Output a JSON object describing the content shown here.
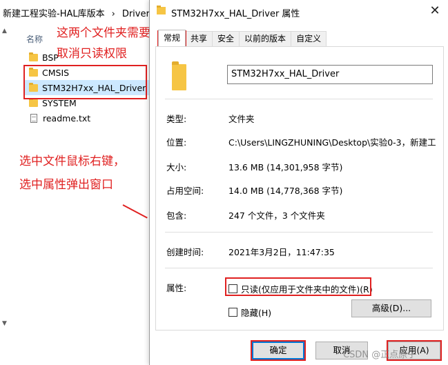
{
  "explorer": {
    "path_part1": "新建工程实验-HAL库版本",
    "path_sep": "›",
    "path_part2": "Drivers",
    "column_header": "名称",
    "items": [
      {
        "name": "BSP",
        "type": "folder"
      },
      {
        "name": "CMSIS",
        "type": "folder"
      },
      {
        "name": "STM32H7xx_HAL_Driver",
        "type": "folder",
        "selected": true
      },
      {
        "name": "SYSTEM",
        "type": "folder"
      },
      {
        "name": "readme.txt",
        "type": "file"
      }
    ]
  },
  "annotations": {
    "note1_line1": "这两个文件夹需要",
    "note1_line2": "取消只读权限",
    "note2_line1": "选中文件鼠标右键，",
    "note2_line2": "选中属性弹出窗口"
  },
  "dialog": {
    "title": "STM32H7xx_HAL_Driver 属性",
    "close_glyph": "✕",
    "tabs": [
      "常规",
      "共享",
      "安全",
      "以前的版本",
      "自定义"
    ],
    "active_tab": "常规",
    "folder_name": "STM32H7xx_HAL_Driver",
    "props": {
      "type_label": "类型:",
      "type_value": "文件夹",
      "location_label": "位置:",
      "location_value": "C:\\Users\\LINGZHUNING\\Desktop\\实验0-3，新建工",
      "size_label": "大小:",
      "size_value": "13.6 MB (14,301,958 字节)",
      "disk_label": "占用空间:",
      "disk_value": "14.0 MB (14,778,368 字节)",
      "contains_label": "包含:",
      "contains_value": "247 个文件，3 个文件夹",
      "created_label": "创建时间:",
      "created_value": "2021年3月2日，11:47:35",
      "attributes_label": "属性:"
    },
    "readonly_label": "只读(仅应用于文件夹中的文件)(R)",
    "hidden_label": "隐藏(H)",
    "advanced_label": "高级(D)...",
    "ok_label": "确定",
    "cancel_label": "取消",
    "apply_label": "应用(A)"
  },
  "watermark": "CSDN @正点原子",
  "colors": {
    "annotation_red": "#e02020",
    "selection_blue": "#cce8ff",
    "folder_yellow": "#f6c544",
    "default_button_border": "#0078d7"
  }
}
